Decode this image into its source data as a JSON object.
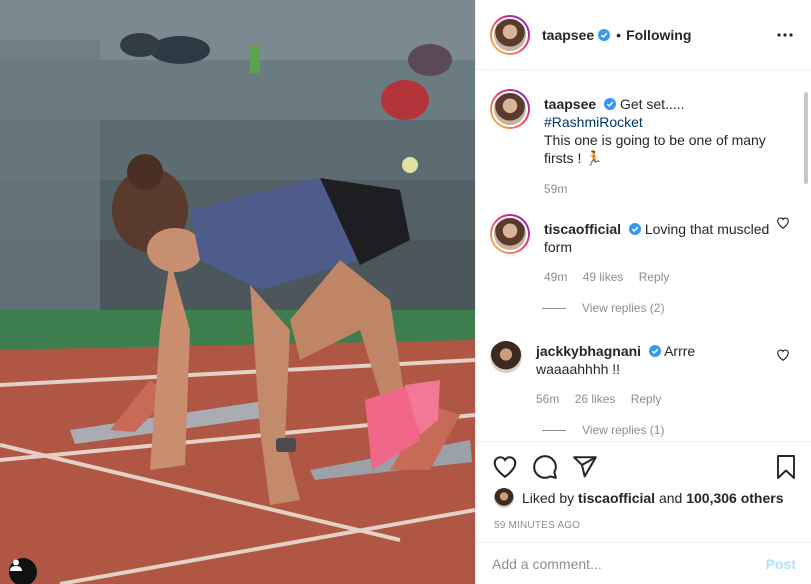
{
  "header": {
    "username": "taapsee",
    "dot": "•",
    "follow_status": "Following"
  },
  "caption": {
    "username": "taapsee",
    "text_1": "Get set.....",
    "hashtag": "#RashmiRocket",
    "text_2": "This one is going to be one of many firsts ! 🏃",
    "time": "59m"
  },
  "comments": [
    {
      "username": "tiscaofficial",
      "text": "Loving that muscled form",
      "time": "49m",
      "likes": "49 likes",
      "reply": "Reply",
      "view_replies": "View replies (2)"
    },
    {
      "username": "jackkybhagnani",
      "text": "Arrre waaaahhhh !!",
      "time": "56m",
      "likes": "26 likes",
      "reply": "Reply",
      "view_replies": "View replies (1)"
    }
  ],
  "likes": {
    "prefix": "Liked by",
    "user": "tiscaofficial",
    "and": "and",
    "count": "100,306 others"
  },
  "posted_ago": "59 MINUTES AGO",
  "add_comment": {
    "placeholder": "Add a comment...",
    "post_label": "Post"
  },
  "colors": {
    "verified": "#3897f0",
    "link": "#00376b",
    "post_disabled": "#b2dffc",
    "muted": "#8e8e8e"
  },
  "icons": [
    "more-options-icon",
    "verified-icon",
    "heart-icon",
    "comment-icon",
    "share-icon",
    "bookmark-icon",
    "user-icon"
  ]
}
